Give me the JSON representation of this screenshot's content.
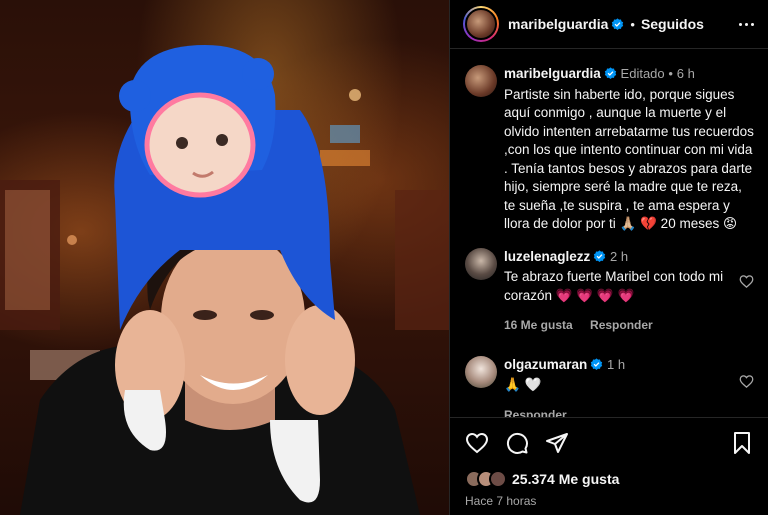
{
  "header": {
    "username": "maribelguardia",
    "separator": "•",
    "follow_status": "Seguidos"
  },
  "caption": {
    "username": "maribelguardia",
    "edited": "Editado",
    "separator": "•",
    "age": "6 h",
    "text": "Partiste sin haberte ido, porque sigues aquí conmigo , aunque la muerte y el olvido intenten arrebatarme tus recuerdos ,con los que intento continuar con mi vida . Tenía tantos besos y abrazos para darte hijo, siempre seré la madre que te reza, te sueña ,te suspira , te ama espera y llora de dolor por ti 🙏🏼 💔 20 meses 😡"
  },
  "comments": [
    {
      "username": "luzelenaglezz",
      "age": "2 h",
      "text": "Te abrazo fuerte Maribel con todo mi corazón 💗 💗 💗 💗",
      "likes": "16 Me gusta",
      "reply": "Responder"
    },
    {
      "username": "olgazumaran",
      "age": "1 h",
      "text": "🙏 🤍",
      "reply": "Responder"
    }
  ],
  "post": {
    "likes": "25.374 Me gusta",
    "time": "Hace 7 horas"
  },
  "icons": {
    "verified": "verified-badge-icon",
    "like": "heart-icon",
    "comment": "comment-icon",
    "share": "share-icon",
    "save": "bookmark-icon",
    "more": "more-icon"
  },
  "colors": {
    "background": "#000000",
    "text": "#f5f5f5",
    "muted": "#a8a8a8",
    "verified": "#0095f6",
    "divider": "#262626"
  }
}
